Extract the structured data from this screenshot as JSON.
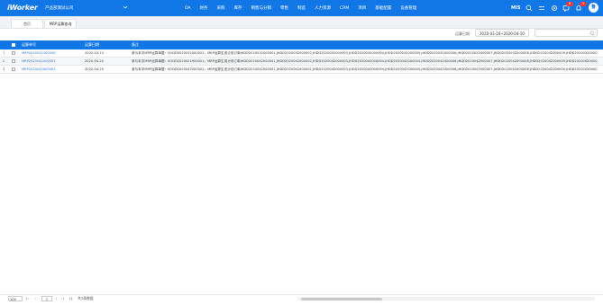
{
  "header": {
    "logo": "iWorker",
    "company": "产品部测试公司",
    "nav": [
      "OA",
      "财务",
      "采购",
      "库存",
      "销售与分销",
      "零售",
      "制造",
      "人力资源",
      "CRM",
      "项目",
      "基础配置",
      "设备管理"
    ],
    "mis_label": "MIS",
    "mail_badge": "9",
    "bell_badge": "9",
    "avatar_text": "鲁",
    "accent": "#1177e6"
  },
  "tabs": {
    "home": "首页",
    "active": "MRP运算查询"
  },
  "filter": {
    "date_label": "运算日期",
    "date_range": "2020-03-16~2020-04-10",
    "search_placeholder": ""
  },
  "table": {
    "headers": {
      "no": "运算单号",
      "date": "运算日期",
      "note": "备注"
    },
    "rows": [
      {
        "num": "1",
        "no": "MRP2020031300006",
        "date": "2020-03-13",
        "note": "参与本次MRP运算单据：SODD2020032000002；MRP运算生成计划订单JHDD2020032000001,JHDD2020032000002,JHDD2020032000003,JHDD2020032000004,JHDD2020032000005,JHDD2020032000006,JHDD2020032000007,JHDD2020032000008,JHDD2020032000009,JHDD20200320000"
      },
      {
        "num": "2",
        "no": "MRP2020042000001",
        "date": "2020-04-20",
        "note": "参与本次MRP运算单据：SODD2020021900001；MRP运算生成计划订单JHDD2020042000001,JHDD2020042000002,JHDD2020042000003,JHDD2020042000004,JHDD2020042000005,JHDD2020042000006,JHDD2020042000007,JHDD2020042000008,JHDD2020042000009,JHDD20200420000"
      },
      {
        "num": "3",
        "no": "MRP2020042000003",
        "date": "2020-04-20",
        "note": "参与本次MRP运算单据：SODD2020042000002；MRP运算生成计划订单JHDD2020042000001,JHDD2020042000002,JHDD2020042000003,JHDD2020042000004,JHDD2020042000005,JHDD2020042000006,JHDD2020042000007,JHDD2020042000008,JHDD2020042000009,JHDD20200420000"
      }
    ]
  },
  "footer": {
    "page_size": "100",
    "first": "|‹",
    "prev": "‹",
    "page": "1",
    "next": "›",
    "last": "›|",
    "page_total": "/1",
    "status": "共3条数据"
  }
}
